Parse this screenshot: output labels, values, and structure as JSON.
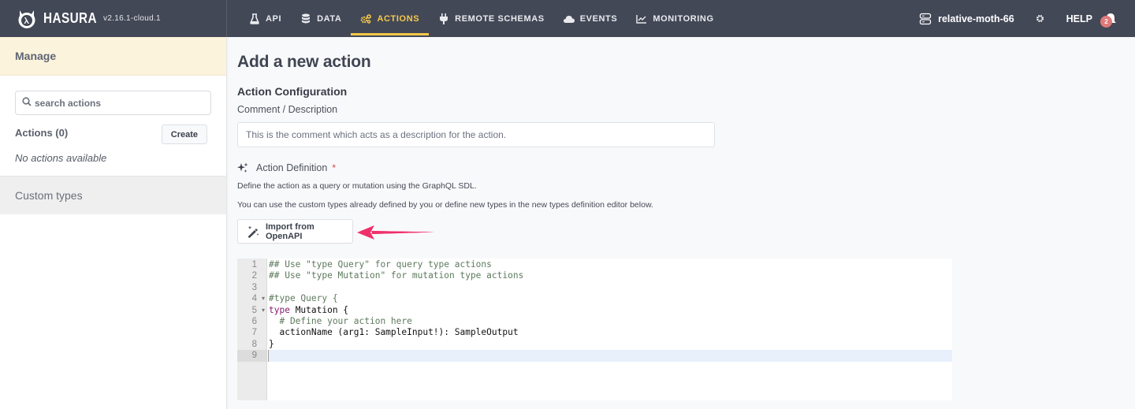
{
  "app": {
    "brand": "HASURA",
    "version": "v2.16.1-cloud.1"
  },
  "nav": {
    "items": [
      {
        "label": "API",
        "icon": "flask-icon",
        "active": false
      },
      {
        "label": "DATA",
        "icon": "database-icon",
        "active": false
      },
      {
        "label": "ACTIONS",
        "icon": "cogs-icon",
        "active": true
      },
      {
        "label": "REMOTE SCHEMAS",
        "icon": "plug-icon",
        "active": false
      },
      {
        "label": "EVENTS",
        "icon": "cloud-icon",
        "active": false
      },
      {
        "label": "MONITORING",
        "icon": "chart-line-icon",
        "active": false
      }
    ],
    "project_name": "relative-moth-66",
    "help_label": "HELP",
    "notification_count": "2",
    "accent_color": "#f7c948"
  },
  "sidebar": {
    "manage_label": "Manage",
    "search_placeholder": "search actions",
    "actions_title": "Actions (0)",
    "create_label": "Create",
    "empty_text": "No actions available",
    "custom_types_label": "Custom types"
  },
  "main": {
    "page_title": "Add a new action",
    "section_title": "Action Configuration",
    "comment_label": "Comment / Description",
    "comment_placeholder": "This is the comment which acts as a description for the action.",
    "definition_label": "Action Definition",
    "required_marker": "*",
    "hint1": "Define the action as a query or mutation using the GraphQL SDL.",
    "hint2": "You can use the custom types already defined by you or define new types in the new types definition editor below.",
    "import_label": "Import from OpenAPI",
    "arrow_color": "#f0306a"
  },
  "editor": {
    "lines": [
      {
        "n": "1",
        "fold": false,
        "tokens": [
          {
            "t": "## Use \"type Query\" for query type actions",
            "c": "comment"
          }
        ]
      },
      {
        "n": "2",
        "fold": false,
        "tokens": [
          {
            "t": "## Use \"type Mutation\" for mutation type actions",
            "c": "comment"
          }
        ]
      },
      {
        "n": "3",
        "fold": false,
        "tokens": []
      },
      {
        "n": "4",
        "fold": true,
        "tokens": [
          {
            "t": "#type Query {",
            "c": "comment"
          }
        ]
      },
      {
        "n": "5",
        "fold": true,
        "tokens": [
          {
            "t": "type",
            "c": "keyword"
          },
          {
            "t": " Mutation {",
            "c": "def"
          }
        ]
      },
      {
        "n": "6",
        "fold": false,
        "tokens": [
          {
            "t": "  # Define your action here",
            "c": "comment"
          }
        ]
      },
      {
        "n": "7",
        "fold": false,
        "tokens": [
          {
            "t": "  actionName (arg1: SampleInput!): SampleOutput",
            "c": "def"
          }
        ]
      },
      {
        "n": "8",
        "fold": false,
        "tokens": [
          {
            "t": "}",
            "c": "def"
          }
        ]
      },
      {
        "n": "9",
        "fold": false,
        "active": true,
        "tokens": []
      }
    ]
  }
}
